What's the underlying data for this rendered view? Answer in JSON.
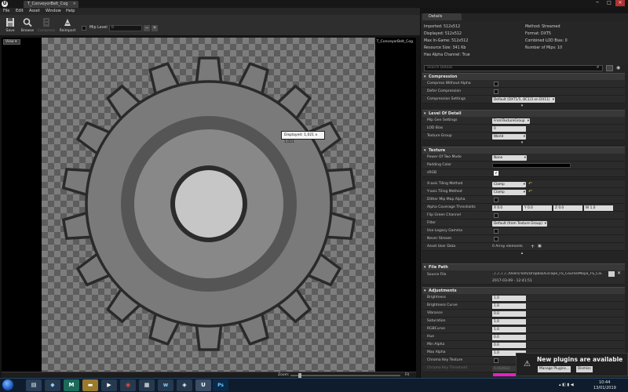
{
  "window": {
    "doc_tab_title": "T_ConveyorBelt_Cog",
    "close_glyph": "✕",
    "controls": [
      "─",
      "□",
      "✕"
    ]
  },
  "menu": {
    "items": [
      "File",
      "Edit",
      "Asset",
      "Window",
      "Help"
    ]
  },
  "toolbar": {
    "buttons": [
      {
        "label": "Save",
        "icon": "save-icon",
        "enabled": true
      },
      {
        "label": "Browse",
        "icon": "browse-icon",
        "enabled": true
      },
      {
        "label": "Compress",
        "icon": "compress-icon",
        "enabled": false
      },
      {
        "label": "Reimport",
        "icon": "reimport-icon",
        "enabled": true
      }
    ],
    "mip_level_label": "Mip Level",
    "mip_level_value": "0",
    "minus": "−",
    "plus": "+"
  },
  "viewport": {
    "view_button": "View ▾",
    "asset_name": "T_ConveyorBelt_Cog",
    "tooltip": "Displayed: 1,021 x 1,021",
    "zoom_label": "Zoom:",
    "zoom_value": "Fit"
  },
  "details": {
    "tab_label": "Details",
    "info_left": [
      "Imported: 512x512",
      "Displayed: 512x512",
      "Max In-Game: 512x512",
      "Resource Size: 341 Kb",
      "Has Alpha Channel: True"
    ],
    "info_right": [
      "Method: Streamed",
      "Format: DXT5",
      "Combined LOD Bias: 0",
      "Number of Mips: 10"
    ],
    "search_placeholder": "Search Details",
    "compression": {
      "title": "Compression",
      "compress_without_alpha": "Compress Without Alpha",
      "defer_compression": "Defer Compression",
      "compression_settings": "Compression Settings",
      "compression_settings_value": "Default (DXT1/5, BC1/3 on DX11)"
    },
    "lod": {
      "title": "Level Of Detail",
      "mip_gen_settings": "Mip Gen Settings",
      "mip_gen_value": "FromTextureGroup",
      "lod_bias": "LOD Bias",
      "lod_bias_value": "0",
      "texture_group": "Texture Group",
      "texture_group_value": "World"
    },
    "texture": {
      "title": "Texture",
      "power_of_two": "Power Of Two Mode",
      "power_of_two_value": "None",
      "padding_color": "Padding Color",
      "srgb": "sRGB",
      "x_tiling": "X-axis Tiling Method",
      "x_tiling_value": "Clamp",
      "y_tiling": "Y-axis Tiling Method",
      "y_tiling_value": "Clamp",
      "dither": "Dither Mip Map Alpha",
      "alpha_cov": "Alpha Coverage Thresholds",
      "alpha_cov_values": [
        {
          "k": "X",
          "v": "0.0"
        },
        {
          "k": "Y",
          "v": "0.0"
        },
        {
          "k": "Z",
          "v": "0.0"
        },
        {
          "k": "W",
          "v": "1.0"
        }
      ],
      "flip_green": "Flip Green Channel",
      "filter": "Filter",
      "filter_value": "Default (from Texture Group)",
      "legacy_gamma": "Use Legacy Gamma",
      "never_stream": "Never Stream",
      "asset_user_data": "Asset User Data",
      "asset_user_data_value": "0 Array elements"
    },
    "file_path": {
      "title": "File Path",
      "source_file": "Source File",
      "source_file_value": "../../../../../Users/Tom/Dropbox/Escape_FS_Course/Maya_FS_Cour...",
      "source_file_date": "2017-03-09 - 12:41:51"
    },
    "adjustments": {
      "title": "Adjustments",
      "rows": [
        {
          "label": "Brightness",
          "value": "1.0"
        },
        {
          "label": "Brightness Curve",
          "value": "1.0"
        },
        {
          "label": "Vibrance",
          "value": "0.0"
        },
        {
          "label": "Saturation",
          "value": "1.0"
        },
        {
          "label": "RGBCurve",
          "value": "1.0"
        },
        {
          "label": "Hue",
          "value": "0.0"
        },
        {
          "label": "Min Alpha",
          "value": "0.0"
        },
        {
          "label": "Max Alpha",
          "value": "1.0"
        },
        {
          "label": "Chroma Key Texture",
          "value": ""
        },
        {
          "label": "Chroma Key Threshold",
          "value": "0.003922"
        }
      ]
    }
  },
  "notification": {
    "title": "New plugins are available",
    "manage": "Manage Plugins...",
    "dismiss": "Dismiss"
  },
  "taskbar": {
    "time": "10:44",
    "date": "13/01/2019"
  },
  "colors": {
    "accent": "#e41fc5",
    "viewport_bg": "#000000",
    "panel_bg": "#242424"
  }
}
